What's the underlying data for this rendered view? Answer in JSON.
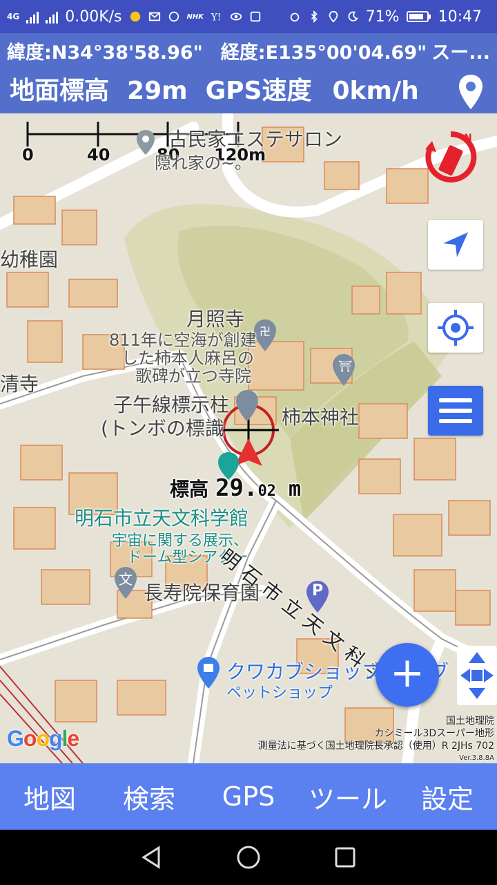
{
  "status": {
    "network_type": "4G",
    "speed": "0.00K/s",
    "battery": "71%",
    "time": "10:47",
    "nhk_badge": "NHK"
  },
  "info": {
    "latitude": "緯度:N34°38'58.96\"",
    "longitude": "経度:E135°00'04.69\"",
    "more": "スー...",
    "elevation_label": "地面標高",
    "elevation_value": "29m",
    "speed_label": "GPS速度",
    "speed_value": "0km/h"
  },
  "scale": {
    "ticks": [
      "0",
      "40",
      "80",
      "120m"
    ]
  },
  "map_labels": {
    "minka": "古民家エステサロン",
    "minka_sub": "隠れ家の~。",
    "kindergarten": "幼稚園",
    "temple_left": "清寺",
    "gesshoji": "月照寺",
    "gesshoji_desc1": "811年に空海が創建",
    "gesshoji_desc2": "した柿本人麻呂の",
    "gesshoji_desc3": "歌碑が立つ寺院",
    "meridian1": "子午線標示柱",
    "meridian2": "(トンボの標識",
    "shrine": "柿本神社",
    "museum": "明石市立天文科学館",
    "museum_desc1": "宇宙に関する展示、",
    "museum_desc2": "ドーム型シアター",
    "nursery": "長寿院保育園",
    "road_text": "明石市立天文科学館",
    "petshop": "クワカブショップ",
    "petshop_suffix": "ブ",
    "petshop_sub": "ペットショップ",
    "pin_letter": "文",
    "parking_letter": "P"
  },
  "crosshair_readout": {
    "label": "標高",
    "integer": "29.",
    "decimal": "02",
    "unit": "m"
  },
  "attribution": {
    "google": "Google",
    "line1": "国土地理院",
    "line2": "カシミール3Dスーパー地形",
    "line3": "測量法に基づく国土地理院長承認（使用）R 2JHs 702",
    "version": "Ver.3.8.8A"
  },
  "fab_label": "+",
  "bottom_nav": [
    "地図",
    "検索",
    "GPS",
    "ツール",
    "設定"
  ],
  "colors": {
    "status_bg": "#3f4fbf",
    "info_bg": "#5a78dc",
    "nav_bg": "#5b80f0",
    "fab": "#3d6ff0",
    "compass_red": "#e5222b",
    "teal_label": "#1b8e86"
  }
}
